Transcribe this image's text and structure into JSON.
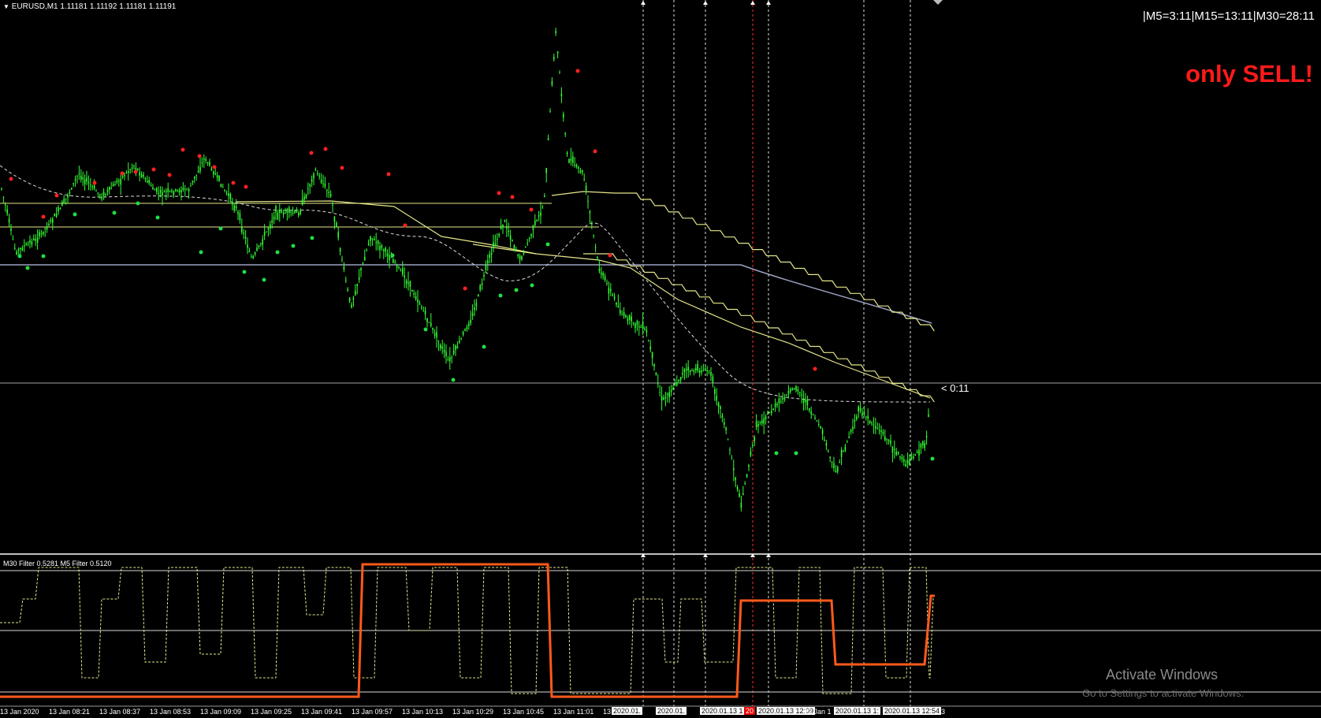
{
  "symbol_label": "EURUSD,M1  1.11181 1.11192 1.11181 1.11191",
  "timer_text": "|M5=3:11|M15=13:11|M30=28:11",
  "signal_text": "only SELL!",
  "countdown_text": "< 0:11",
  "filter_label": "M30 Filter 0.5281  M5 Filter 0.5120",
  "time_axis": [
    {
      "label": "13 Jan 2020",
      "style": "normal"
    },
    {
      "label": "13 Jan 08:21",
      "style": "normal"
    },
    {
      "label": "13 Jan 08:37",
      "style": "normal"
    },
    {
      "label": "13 Jan 08:53",
      "style": "normal"
    },
    {
      "label": "13 Jan 09:09",
      "style": "normal"
    },
    {
      "label": "13 Jan 09:25",
      "style": "normal"
    },
    {
      "label": "13 Jan 09:41",
      "style": "normal"
    },
    {
      "label": "13 Jan 09:57",
      "style": "normal"
    },
    {
      "label": "13 Jan 10:13",
      "style": "normal"
    },
    {
      "label": "13 Jan 10:29",
      "style": "normal"
    },
    {
      "label": "13 Jan 10:45",
      "style": "normal"
    },
    {
      "label": "13 Jan 11:01",
      "style": "normal"
    },
    {
      "label": "13",
      "style": "normal"
    },
    {
      "label": "2020.01.",
      "style": "hl"
    },
    {
      "label": "2020.01.",
      "style": "hl"
    },
    {
      "label": "2020.01.13 1",
      "style": "hl"
    },
    {
      "label": "20",
      "style": "red"
    },
    {
      "label": "2020.01.13 12:09",
      "style": "hl"
    },
    {
      "label": "13 Jan 1",
      "style": "normal"
    },
    {
      "label": "2020.01.13 1:",
      "style": "hl"
    },
    {
      "label": "2020.01.13 12:54",
      "style": "hl"
    },
    {
      "label": "3",
      "style": "normal"
    }
  ],
  "watermark": {
    "title": "Activate Windows",
    "subtitle": "Go to Settings to activate Windows."
  },
  "colors": {
    "background": "#000000",
    "candles": "#33ff33",
    "fractal_up": "#ff2020",
    "fractal_down": "#22dd44",
    "ma_yellow": "#e6e68a",
    "ma_grey": "#9aa0c0",
    "m30_filter": "#ff5a1a",
    "m5_filter": "#e6e68a",
    "signal": "#ff1a1a"
  },
  "icons": {
    "symbol_dropdown": "triangle-down-icon",
    "scroll_marker": "diamond-icon"
  }
}
